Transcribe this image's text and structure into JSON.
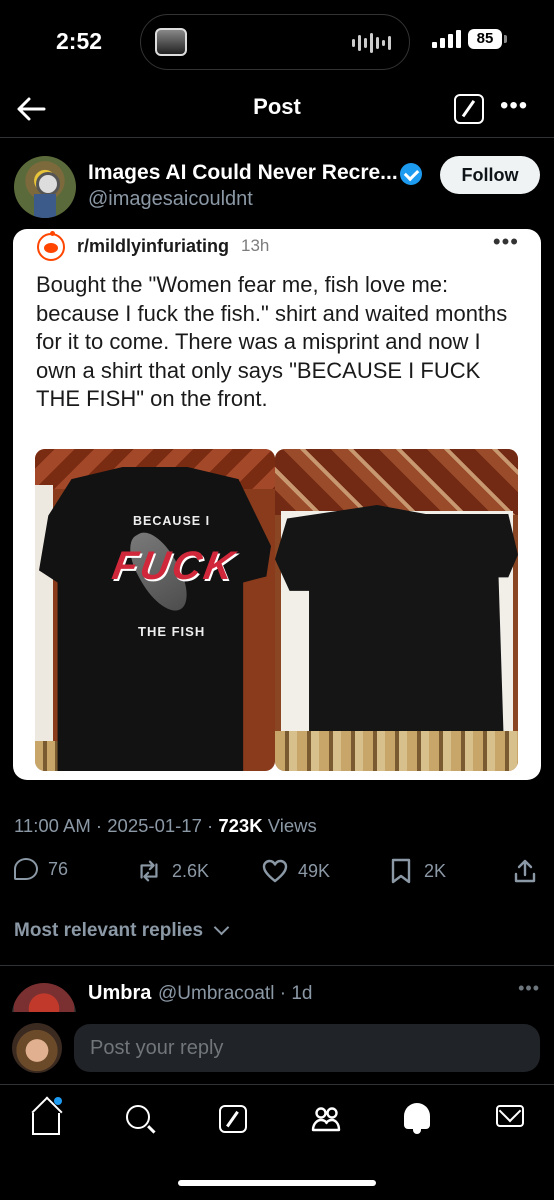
{
  "status": {
    "time": "2:52",
    "battery": "85"
  },
  "header": {
    "title": "Post"
  },
  "author": {
    "name": "Images AI Could Never Recre...",
    "handle": "@imagesaicouldnt",
    "follow_label": "Follow"
  },
  "embed": {
    "subreddit": "r/mildlyinfuriating",
    "age": "13h",
    "text": "Bought the \"Women fear me, fish love me: because I fuck the fish.\" shirt and waited months for it to come. There was a misprint and now I own a shirt that only says \"BECAUSE I FUCK THE FISH\" on the front.",
    "shirt_print": {
      "line1": "BECAUSE I",
      "line2": "FUCK",
      "line3": "THE FISH"
    }
  },
  "meta": {
    "time": "11:00 AM",
    "date": "2025-01-17",
    "views_count": "723K",
    "views_label": "Views"
  },
  "actions": {
    "replies": "76",
    "reposts": "2.6K",
    "likes": "49K",
    "bookmarks": "2K"
  },
  "replies_section": {
    "sort_label": "Most relevant replies"
  },
  "reply": {
    "name": "Umbra",
    "handle": "@Umbracoatl · 1d"
  },
  "compose": {
    "placeholder": "Post your reply"
  },
  "colors": {
    "accent": "#1d9bf0",
    "background": "#000000",
    "muted": "#8b98a5",
    "reddit": "#ff4500"
  }
}
